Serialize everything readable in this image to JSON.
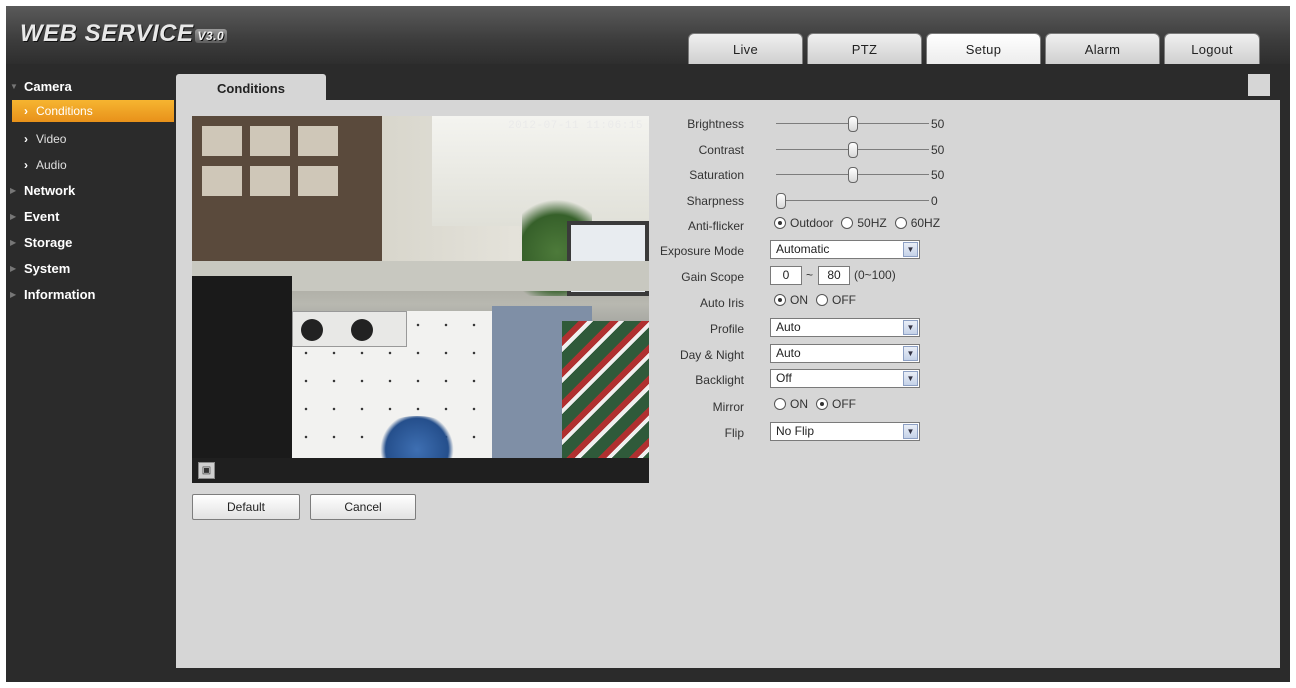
{
  "header": {
    "logo_text": "WEB SERVICE",
    "logo_version": "V3.0",
    "tabs": [
      {
        "label": "Live"
      },
      {
        "label": "PTZ"
      },
      {
        "label": "Setup"
      },
      {
        "label": "Alarm"
      },
      {
        "label": "Logout"
      }
    ],
    "active_tab": "Setup"
  },
  "sidebar": {
    "camera": {
      "label": "Camera",
      "expanded": true
    },
    "camera_items": [
      {
        "label": "Conditions",
        "active": true
      },
      {
        "label": "Video"
      },
      {
        "label": "Audio"
      }
    ],
    "categories": [
      {
        "label": "Network"
      },
      {
        "label": "Event"
      },
      {
        "label": "Storage"
      },
      {
        "label": "System"
      },
      {
        "label": "Information"
      }
    ]
  },
  "content": {
    "tab_label": "Conditions",
    "video_timestamp": "2012-07-11 11:06:15",
    "buttons": {
      "default": "Default",
      "cancel": "Cancel"
    }
  },
  "settings": {
    "brightness": {
      "label": "Brightness",
      "value": 50,
      "max": 100
    },
    "contrast": {
      "label": "Contrast",
      "value": 50,
      "max": 100
    },
    "saturation": {
      "label": "Saturation",
      "value": 50,
      "max": 100
    },
    "sharpness": {
      "label": "Sharpness",
      "value": 0,
      "max": 100
    },
    "anti_flicker": {
      "label": "Anti-flicker",
      "options": [
        "Outdoor",
        "50HZ",
        "60HZ"
      ],
      "selected": "Outdoor"
    },
    "exposure_mode": {
      "label": "Exposure Mode",
      "value": "Automatic"
    },
    "gain_scope": {
      "label": "Gain Scope",
      "min": "0",
      "sep": "~",
      "max": "80",
      "range": "(0~100)"
    },
    "auto_iris": {
      "label": "Auto Iris",
      "on": "ON",
      "off": "OFF",
      "selected": "ON"
    },
    "profile": {
      "label": "Profile",
      "value": "Auto"
    },
    "day_night": {
      "label": "Day & Night",
      "value": "Auto"
    },
    "backlight": {
      "label": "Backlight",
      "value": "Off"
    },
    "mirror": {
      "label": "Mirror",
      "on": "ON",
      "off": "OFF",
      "selected": "OFF"
    },
    "flip": {
      "label": "Flip",
      "value": "No Flip"
    }
  },
  "colors": {
    "accent": "#f0a428",
    "background": "#2b2b2b",
    "panel": "#d6d6d6"
  }
}
